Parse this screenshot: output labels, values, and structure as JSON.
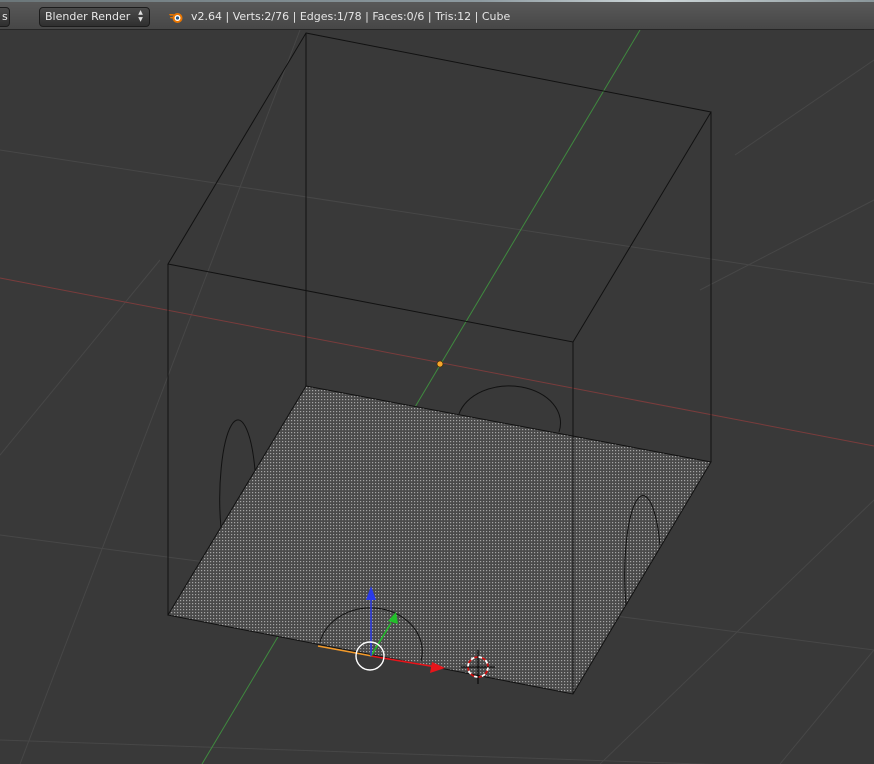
{
  "header": {
    "menu_stub_label": "s",
    "render_engine": "Blender Render",
    "stats": "v2.64 | Verts:2/76 | Edges:1/78 | Faces:0/6 | Tris:12 | Cube"
  },
  "colors": {
    "viewport_bg": "#393939",
    "grid_line": "#474747",
    "x_axis": "#7a3c3c",
    "y_axis": "#3f8a3f",
    "wire": "#111111",
    "selected_edge": "#f39a2a",
    "manipulator_x": "#e8141a",
    "manipulator_y": "#22c02a",
    "manipulator_z": "#2a3ae8",
    "origin_dot": "#f6a52c"
  },
  "icons": {
    "logo": "blender-logo-icon",
    "dropdown": "up-down-arrows-icon",
    "cursor": "3d-cursor-icon"
  }
}
